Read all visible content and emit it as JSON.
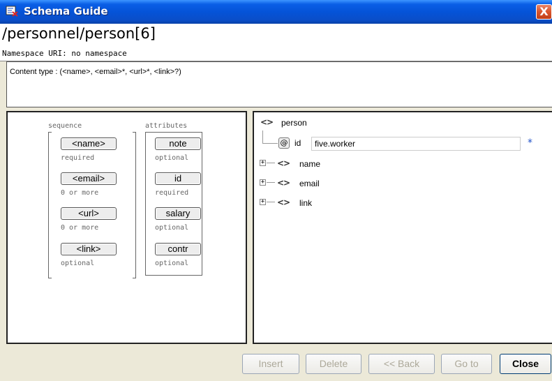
{
  "window": {
    "title": "Schema Guide",
    "close_glyph": "X"
  },
  "header": {
    "path": "/personnel/person[6]",
    "namespace": "Namespace URI: no namespace"
  },
  "content_type": "Content type : (<name>, <email>*, <url>*, <link>?)",
  "left_pane": {
    "sequence_label": "sequence",
    "attributes_label": "attributes",
    "sequence_items": [
      {
        "label": "<name>",
        "note": "required"
      },
      {
        "label": "<email>",
        "note": "0 or more"
      },
      {
        "label": "<url>",
        "note": "0 or more"
      },
      {
        "label": "<link>",
        "note": "optional"
      }
    ],
    "attribute_items": [
      {
        "label": "note",
        "note": "optional"
      },
      {
        "label": "id",
        "note": "required"
      },
      {
        "label": "salary",
        "note": "optional"
      },
      {
        "label": "contr",
        "note": "optional"
      }
    ]
  },
  "tree": {
    "root_icon": "element-icon",
    "root": "person",
    "attribute": {
      "icon": "attribute-icon",
      "icon_glyph": "@",
      "name": "id",
      "value": "five.worker",
      "required_mark": "*"
    },
    "children": [
      {
        "expand_glyph": "+",
        "icon": "element-icon",
        "name": "name"
      },
      {
        "expand_glyph": "+",
        "icon": "element-icon",
        "name": "email"
      },
      {
        "expand_glyph": "+",
        "icon": "element-icon",
        "name": "link"
      }
    ],
    "element_glyph": "<>"
  },
  "buttons": {
    "insert": "Insert",
    "delete": "Delete",
    "back": "<< Back",
    "goto": "Go to",
    "close": "Close"
  }
}
